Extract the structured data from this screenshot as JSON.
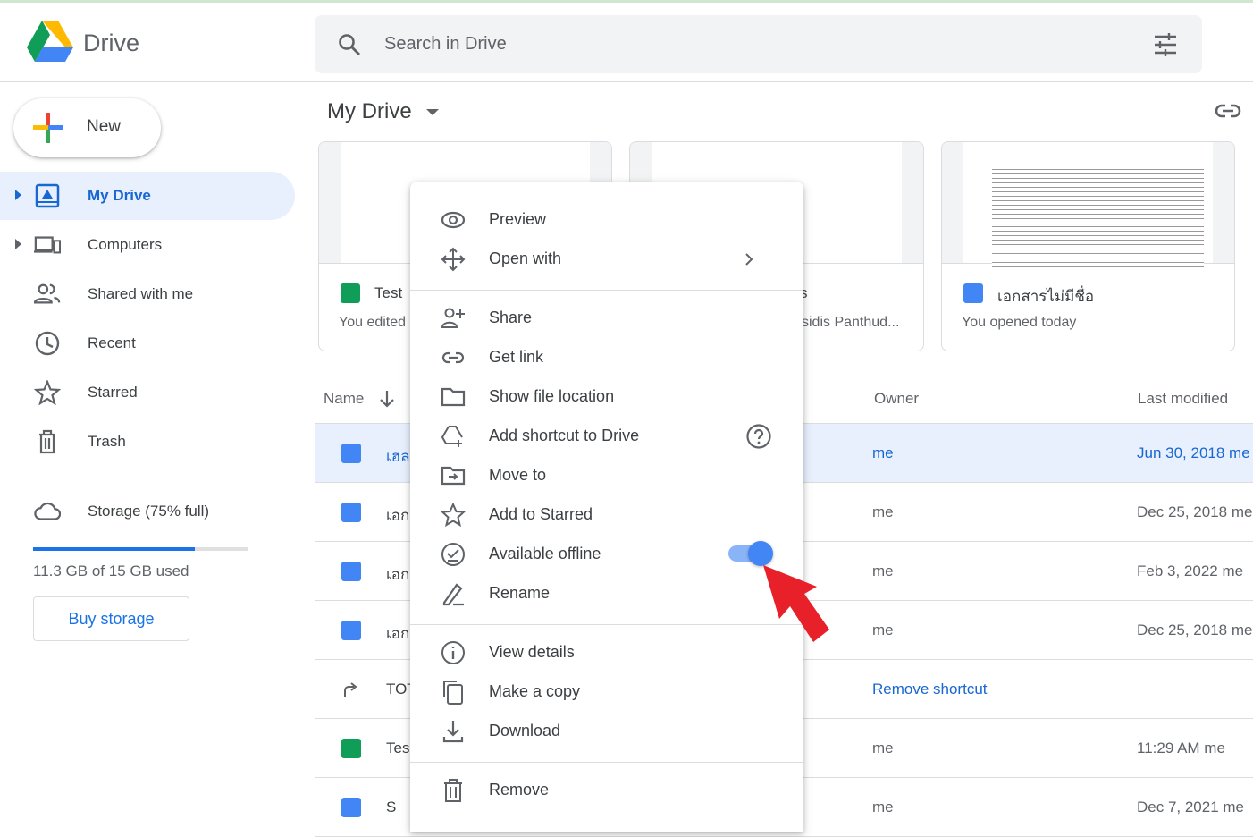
{
  "app": {
    "name": "Drive"
  },
  "search": {
    "placeholder": "Search in Drive"
  },
  "sidebar": {
    "new_label": "New",
    "items": [
      {
        "label": "My Drive",
        "active": true
      },
      {
        "label": "Computers"
      },
      {
        "label": "Shared with me"
      },
      {
        "label": "Recent"
      },
      {
        "label": "Starred"
      },
      {
        "label": "Trash"
      }
    ],
    "storage": {
      "label": "Storage (75% full)",
      "used_text": "11.3 GB of 15 GB used",
      "percent": 75,
      "buy_label": "Buy storage"
    }
  },
  "main": {
    "title": "My Drive",
    "cards": [
      {
        "title": "Test",
        "subtitle": "You edited",
        "type": "sheet"
      },
      {
        "title": "s",
        "subtitle": "sidis Panthud...",
        "type": "doc"
      },
      {
        "title": "เอกสารไม่มีชื่อ",
        "subtitle": "You opened today",
        "type": "doc"
      }
    ],
    "columns": {
      "name": "Name",
      "owner": "Owner",
      "modified": "Last modified"
    },
    "rows": [
      {
        "name": "เฮล",
        "owner": "me",
        "modified": "Jun 30, 2018 me",
        "type": "doc",
        "selected": true
      },
      {
        "name": "เอก",
        "owner": "me",
        "modified": "Dec 25, 2018 me",
        "type": "doc"
      },
      {
        "name": "เอก",
        "owner": "me",
        "modified": "Feb 3, 2022 me",
        "type": "doc"
      },
      {
        "name": "เอก",
        "owner": "me",
        "modified": "Dec 25, 2018 me",
        "type": "doc"
      },
      {
        "name": "TOT",
        "owner": "Remove shortcut",
        "modified": "",
        "type": "shortcut"
      },
      {
        "name": "Tes",
        "owner": "me",
        "modified": "11:29 AM me",
        "type": "sheet"
      },
      {
        "name": "S",
        "owner": "me",
        "modified": "Dec 7, 2021 me",
        "type": "doc"
      }
    ]
  },
  "context_menu": {
    "items": [
      {
        "label": "Preview",
        "icon": "eye-icon"
      },
      {
        "label": "Open with",
        "icon": "move-arrows-icon"
      },
      {
        "label": "Share",
        "icon": "person-add-icon"
      },
      {
        "label": "Get link",
        "icon": "link-icon"
      },
      {
        "label": "Show file location",
        "icon": "folder-icon"
      },
      {
        "label": "Add shortcut to Drive",
        "icon": "drive-shortcut-icon"
      },
      {
        "label": "Move to",
        "icon": "folder-move-icon"
      },
      {
        "label": "Add to Starred",
        "icon": "star-icon"
      },
      {
        "label": "Available offline",
        "icon": "offline-check-icon",
        "toggle": true
      },
      {
        "label": "Rename",
        "icon": "pencil-icon"
      },
      {
        "label": "View details",
        "icon": "info-icon"
      },
      {
        "label": "Make a copy",
        "icon": "copy-icon"
      },
      {
        "label": "Download",
        "icon": "download-icon"
      },
      {
        "label": "Remove",
        "icon": "trash-icon"
      }
    ]
  },
  "colors": {
    "accent": "#1a73e8",
    "active_bg": "#e8f0fe",
    "arrow": "#e8202a"
  }
}
